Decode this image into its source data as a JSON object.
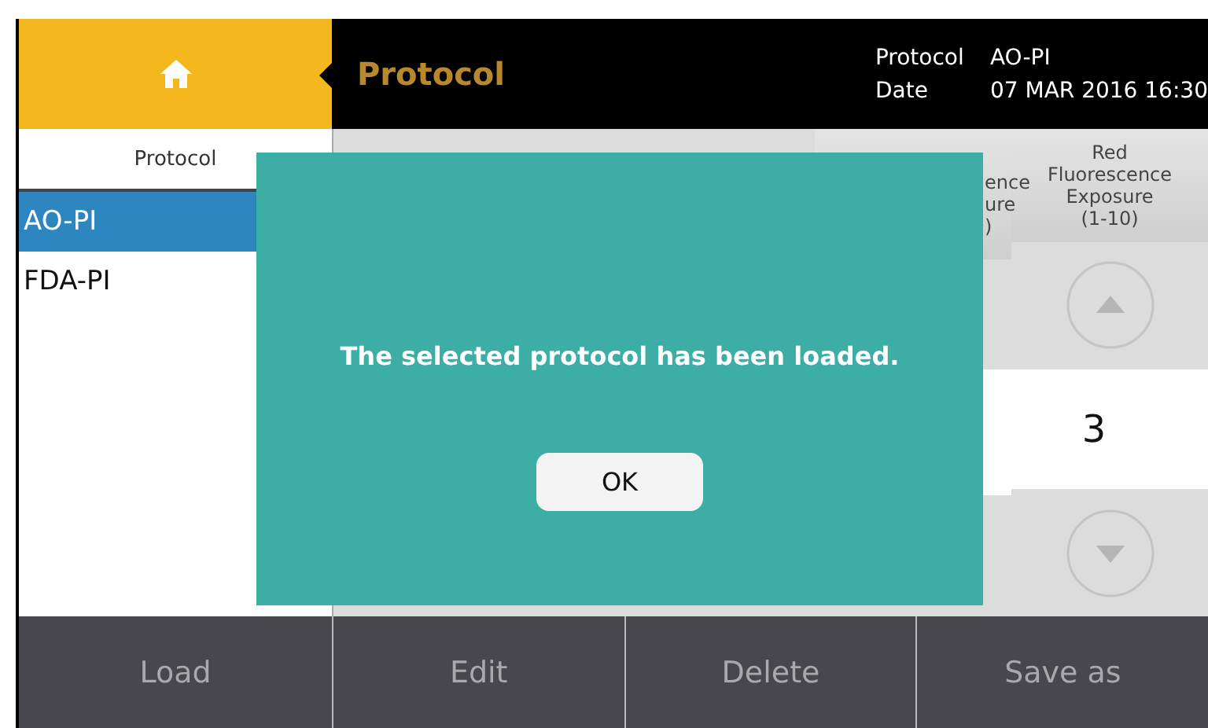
{
  "header": {
    "title": "Protocol",
    "info": [
      {
        "label": "Protocol",
        "value": "AO-PI"
      },
      {
        "label": "Date",
        "value": "07 MAR 2016 16:30"
      }
    ]
  },
  "sidebar": {
    "heading": "Protocol",
    "items": [
      {
        "label": "AO-PI",
        "selected": true
      },
      {
        "label": "FDA-PI",
        "selected": false
      }
    ]
  },
  "columns": [
    {
      "header_lines": [
        "ence",
        "ure",
        ")"
      ]
    },
    {
      "header_lines": [
        "Red",
        "Fluorescence",
        "Exposure",
        "(1-10)"
      ],
      "value": "3"
    }
  ],
  "dialog": {
    "message": "The selected protocol has been loaded.",
    "button": "OK"
  },
  "toolbar": [
    "Load",
    "Edit",
    "Delete",
    "Save as"
  ]
}
